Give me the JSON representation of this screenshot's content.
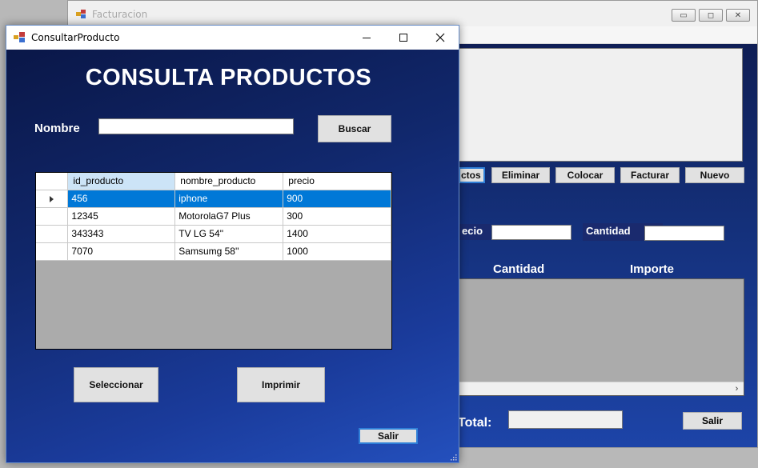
{
  "background_window": {
    "title": "Facturacion",
    "controls": {
      "minimize": "▭",
      "maximize": "◻",
      "close": "✕"
    },
    "buttons": {
      "productos": "ctos",
      "eliminar": "Eliminar",
      "colocar": "Colocar",
      "facturar": "Facturar",
      "nuevo": "Nuevo"
    },
    "precio_label": "ecio",
    "cantidad_label": "Cantidad",
    "grid_columns": {
      "cantidad": "Cantidad",
      "importe": "Importe"
    },
    "scroll_right_icon": "›",
    "total_label": "Total:",
    "salir_label": "Salir"
  },
  "foreground_window": {
    "title": "ConsultarProducto",
    "heading": "CONSULTA PRODUCTOS",
    "nombre_label": "Nombre",
    "nombre_value": "",
    "buscar_label": "Buscar",
    "grid": {
      "columns": [
        "id_producto",
        "nombre_producto",
        "precio"
      ],
      "rows": [
        {
          "id": "456",
          "nombre": "iphone",
          "precio": "900"
        },
        {
          "id": "12345",
          "nombre": "MotorolaG7 Plus",
          "precio": "300"
        },
        {
          "id": "343343",
          "nombre": "TV LG 54''",
          "precio": "1400"
        },
        {
          "id": "7070",
          "nombre": "Samsumg 58''",
          "precio": "1000"
        }
      ],
      "selected_row": 0
    },
    "seleccionar_label": "Seleccionar",
    "imprimir_label": "Imprimir",
    "salir_label": "Salir"
  },
  "colors": {
    "form_gradient_dark": "#0a1748",
    "form_gradient_light": "#2450bd",
    "selection": "#0078d7",
    "sorted_header": "#cce4f7"
  }
}
